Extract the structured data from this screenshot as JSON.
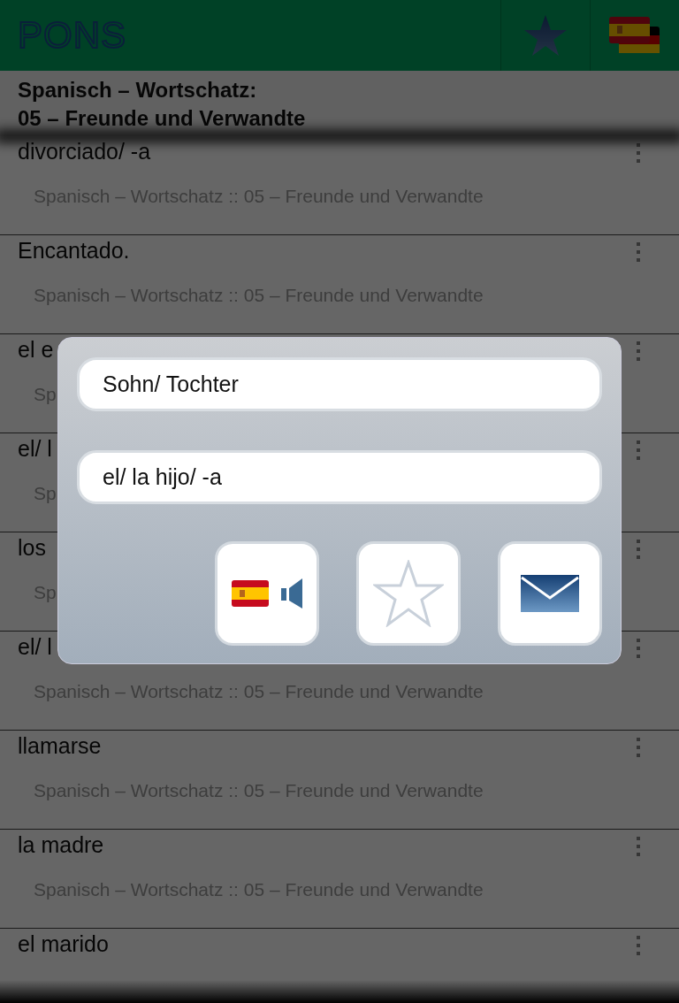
{
  "app_bar": {
    "logo": "PONS"
  },
  "header": {
    "lines": [
      "Spanisch – Wortschatz:",
      "05 – Freunde und Verwandte"
    ]
  },
  "entries": [
    {
      "term": "divorciado/ -a",
      "subtitle": "Spanisch – Wortschatz :: 05 – Freunde und Verwandte"
    },
    {
      "term": "Encantado.",
      "subtitle": "Spanisch – Wortschatz :: 05 – Freunde und Verwandte"
    },
    {
      "term": "el e",
      "subtitle": "Sp"
    },
    {
      "term": "el/ l",
      "subtitle": "Sp"
    },
    {
      "term": "los",
      "subtitle": "Sp"
    },
    {
      "term": "el/ l",
      "subtitle": "Spanisch – Wortschatz :: 05 – Freunde und Verwandte"
    },
    {
      "term": "llamarse",
      "subtitle": "Spanisch – Wortschatz :: 05 – Freunde und Verwandte"
    },
    {
      "term": "la madre",
      "subtitle": "Spanisch – Wortschatz :: 05 – Freunde und Verwandte"
    },
    {
      "term": "el marido"
    }
  ],
  "dialog": {
    "translation": "Sohn/ Tochter",
    "term": "el/ la hijo/ -a"
  }
}
